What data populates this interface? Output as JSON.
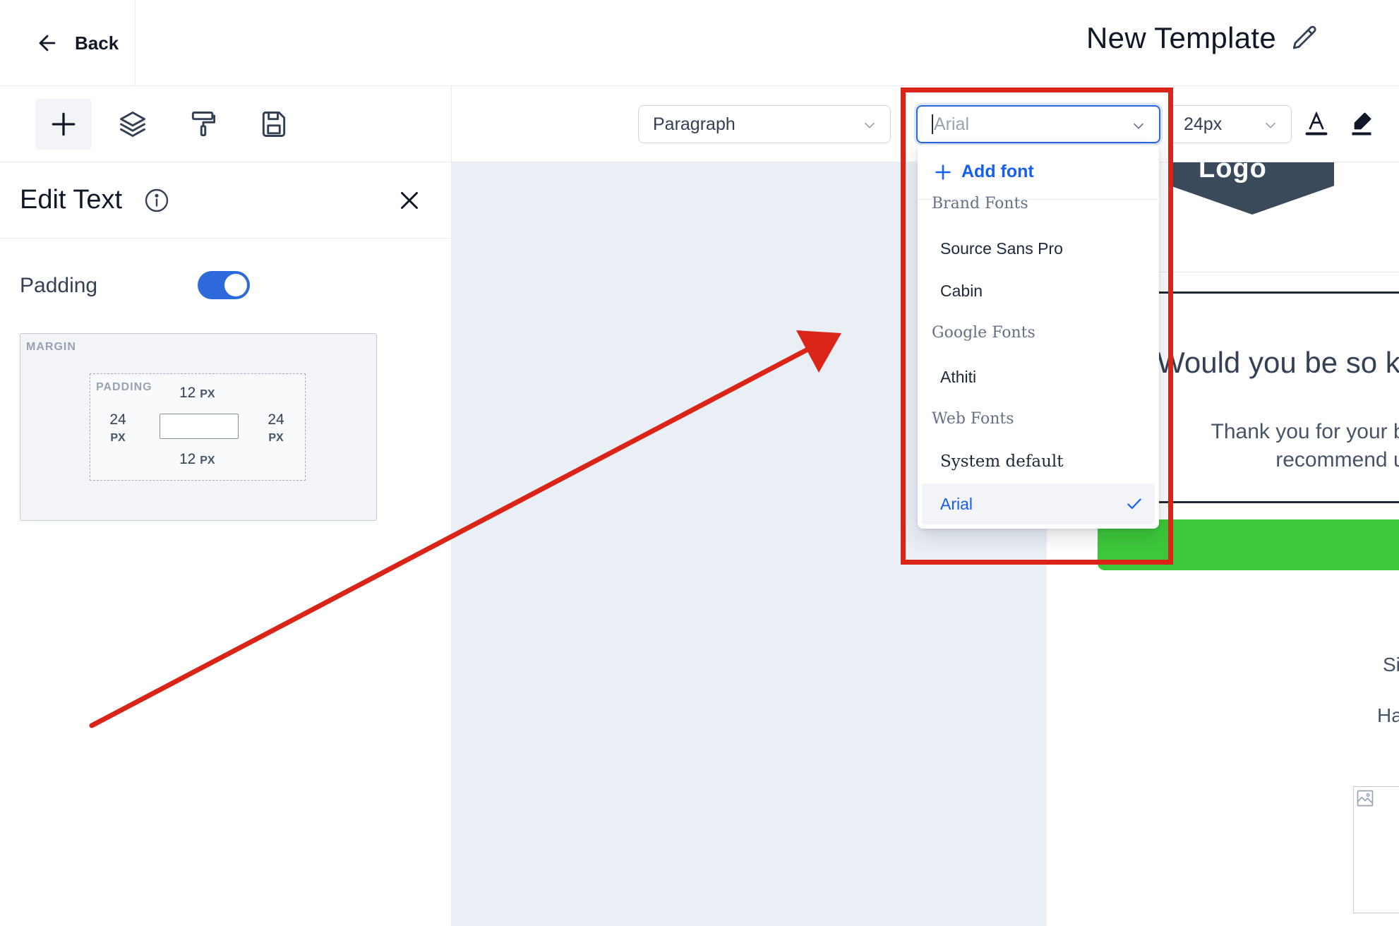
{
  "header": {
    "back_label": "Back",
    "page_title": "New Template"
  },
  "toolbar": {
    "tools": [
      "add",
      "layers",
      "paint-roller",
      "save"
    ],
    "block_type": "Paragraph",
    "font_input_value": "",
    "font_input_placeholder": "Arial",
    "font_size": "24px"
  },
  "left_panel": {
    "title": "Edit Text",
    "padding_label": "Padding",
    "padding_enabled": true,
    "margin_caption": "MARGIN",
    "padding_caption": "PADDING",
    "padding": {
      "top": "12",
      "right": "24",
      "bottom": "12",
      "left": "24",
      "unit": "PX"
    }
  },
  "font_dropdown": {
    "add_font_label": "Add font",
    "groups": [
      {
        "name": "Brand Fonts",
        "items": [
          "Source Sans Pro",
          "Cabin"
        ]
      },
      {
        "name": "Google Fonts",
        "items": [
          "Athiti"
        ]
      },
      {
        "name": "Web Fonts",
        "items": [
          "System default",
          "Arial"
        ]
      }
    ],
    "selected": "Arial"
  },
  "email_preview": {
    "logo_text": "Logo",
    "heading": "Would you be so k",
    "body_line1": "Thank you for your busir",
    "body_line2": "recommend us to",
    "side_text_1": "Si",
    "side_text_2": "Ha"
  },
  "colors": {
    "accent": "#2e69db",
    "link": "#155eef",
    "annotation_red": "#db2418",
    "cta_green": "#3cc83a"
  }
}
